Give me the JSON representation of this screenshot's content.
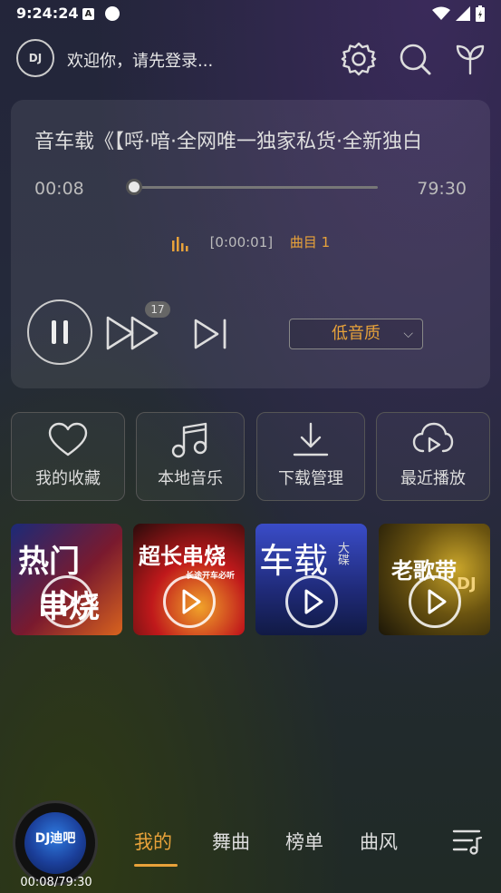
{
  "status_bar": {
    "time": "9:24:24",
    "notification_letter": "A"
  },
  "header": {
    "logo_text": "DJ",
    "welcome_text": "欢迎你，请先登录..."
  },
  "player": {
    "song_title": "音车载《【哷·喑·全网唯一独家私货·全新独白",
    "current_time": "00:08",
    "total_time": "79:30",
    "progress": 0.0017,
    "timestamp": "[0:00:01]",
    "track_label": "曲目 1",
    "ff_badge": "17",
    "quality": "低音质"
  },
  "quick_actions": [
    {
      "label": "我的收藏",
      "icon": "heart-icon"
    },
    {
      "label": "本地音乐",
      "icon": "music-note-icon"
    },
    {
      "label": "下载管理",
      "icon": "download-icon"
    },
    {
      "label": "最近播放",
      "icon": "cloud-play-icon"
    }
  ],
  "covers": [
    {
      "title": "热门串烧",
      "line1": "热门",
      "line2": "串烧"
    },
    {
      "title": "超长串烧",
      "line1": "超长串烧",
      "subtitle": "长途开车必听"
    },
    {
      "title": "车载大碟",
      "line1": "车载",
      "line2": "大碟"
    },
    {
      "title": "老歌带",
      "line1": "老歌带",
      "badge": "DJ"
    }
  ],
  "mini_player": {
    "disc_text": "DJ迪吧",
    "time": "00:08/79:30"
  },
  "tabs": [
    {
      "label": "我的",
      "active": true
    },
    {
      "label": "舞曲",
      "active": false
    },
    {
      "label": "榜单",
      "active": false
    },
    {
      "label": "曲风",
      "active": false
    }
  ],
  "colors": {
    "accent": "#e8a23a",
    "text": "#dddddd"
  }
}
